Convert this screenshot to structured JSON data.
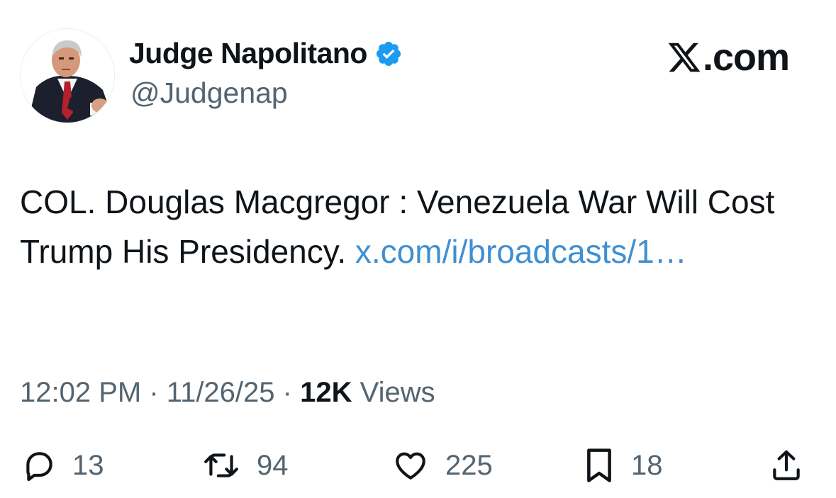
{
  "author": {
    "display_name": "Judge Napolitano",
    "handle": "@Judgenap",
    "verified": true
  },
  "brand": {
    "label": ".com",
    "icon": "x-logo-icon"
  },
  "tweet": {
    "text": "COL. Douglas Macgregor : Venezuela War Will Cost Trump His Presidency. ",
    "link_text": "x.com/i/broadcasts/1…"
  },
  "meta": {
    "time": "12:02 PM",
    "separator": "·",
    "date": "11/26/25",
    "views_count": "12K",
    "views_label": "Views"
  },
  "actions": {
    "reply": {
      "icon": "reply-icon",
      "count": "13"
    },
    "retweet": {
      "icon": "retweet-icon",
      "count": "94"
    },
    "like": {
      "icon": "heart-icon",
      "count": "225"
    },
    "bookmark": {
      "icon": "bookmark-icon",
      "count": "18"
    },
    "share": {
      "icon": "share-icon"
    }
  },
  "colors": {
    "text": "#0f1419",
    "secondary": "#536471",
    "link": "#3f8fd2",
    "verified": "#1d9bf0"
  }
}
